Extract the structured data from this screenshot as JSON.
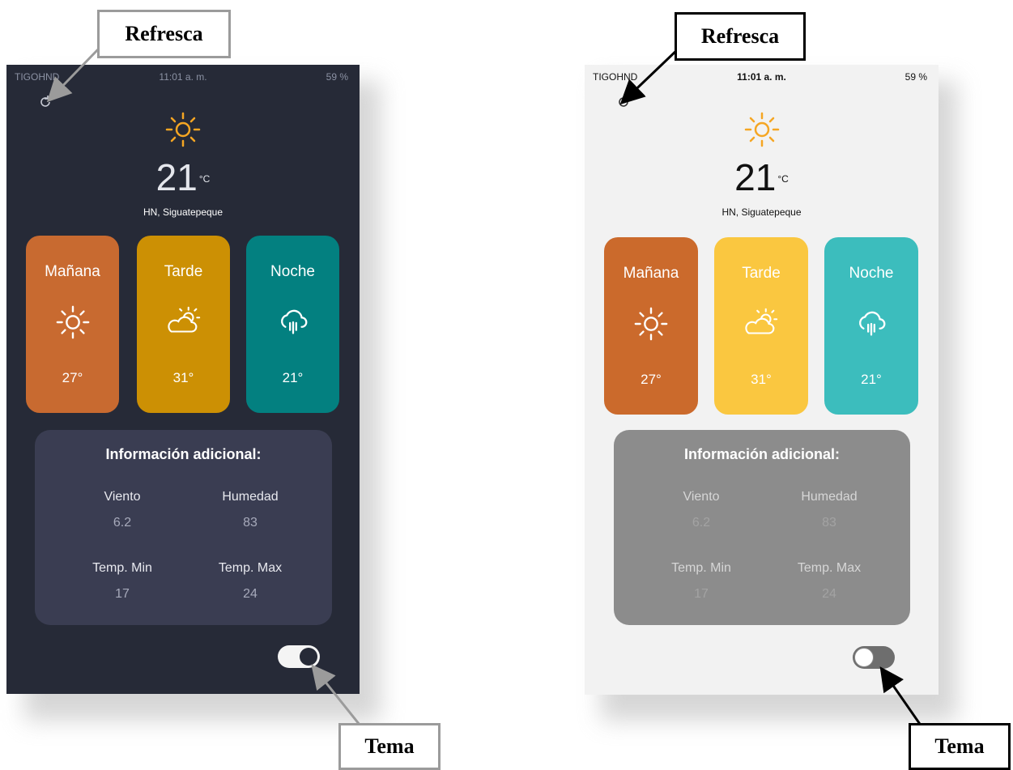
{
  "status_bar": {
    "carrier": "TIGOHND",
    "time": "11:01 a. m.",
    "battery": "59 %"
  },
  "weather": {
    "temperature": "21",
    "unit": "°C",
    "location": "HN,  Siguatepeque"
  },
  "forecast": [
    {
      "label": "Mañana",
      "temp": "27°",
      "icon": "sun-icon"
    },
    {
      "label": "Tarde",
      "temp": "31°",
      "icon": "partly-cloudy-icon"
    },
    {
      "label": "Noche",
      "temp": "21°",
      "icon": "rain-cloud-icon"
    }
  ],
  "info": {
    "title": "Información adicional:",
    "items": [
      {
        "label": "Viento",
        "value": "6.2"
      },
      {
        "label": "Humedad",
        "value": "83"
      },
      {
        "label": "Temp. Min",
        "value": "17"
      },
      {
        "label": "Temp. Max",
        "value": "24"
      }
    ]
  },
  "callouts": {
    "refresh": "Refresca",
    "theme": "Tema"
  },
  "themes": {
    "dark_on": true,
    "light_on": false
  },
  "colors": {
    "dark_bg": "#262a37",
    "light_bg": "#f2f2f2",
    "manana_dark": "#c86a30",
    "tarde_dark": "#cc9004",
    "noche_dark": "#038080",
    "manana_light": "#cb6a2c",
    "tarde_light": "#fac740",
    "noche_light": "#3cbdbd",
    "sun": "#f5a623"
  }
}
